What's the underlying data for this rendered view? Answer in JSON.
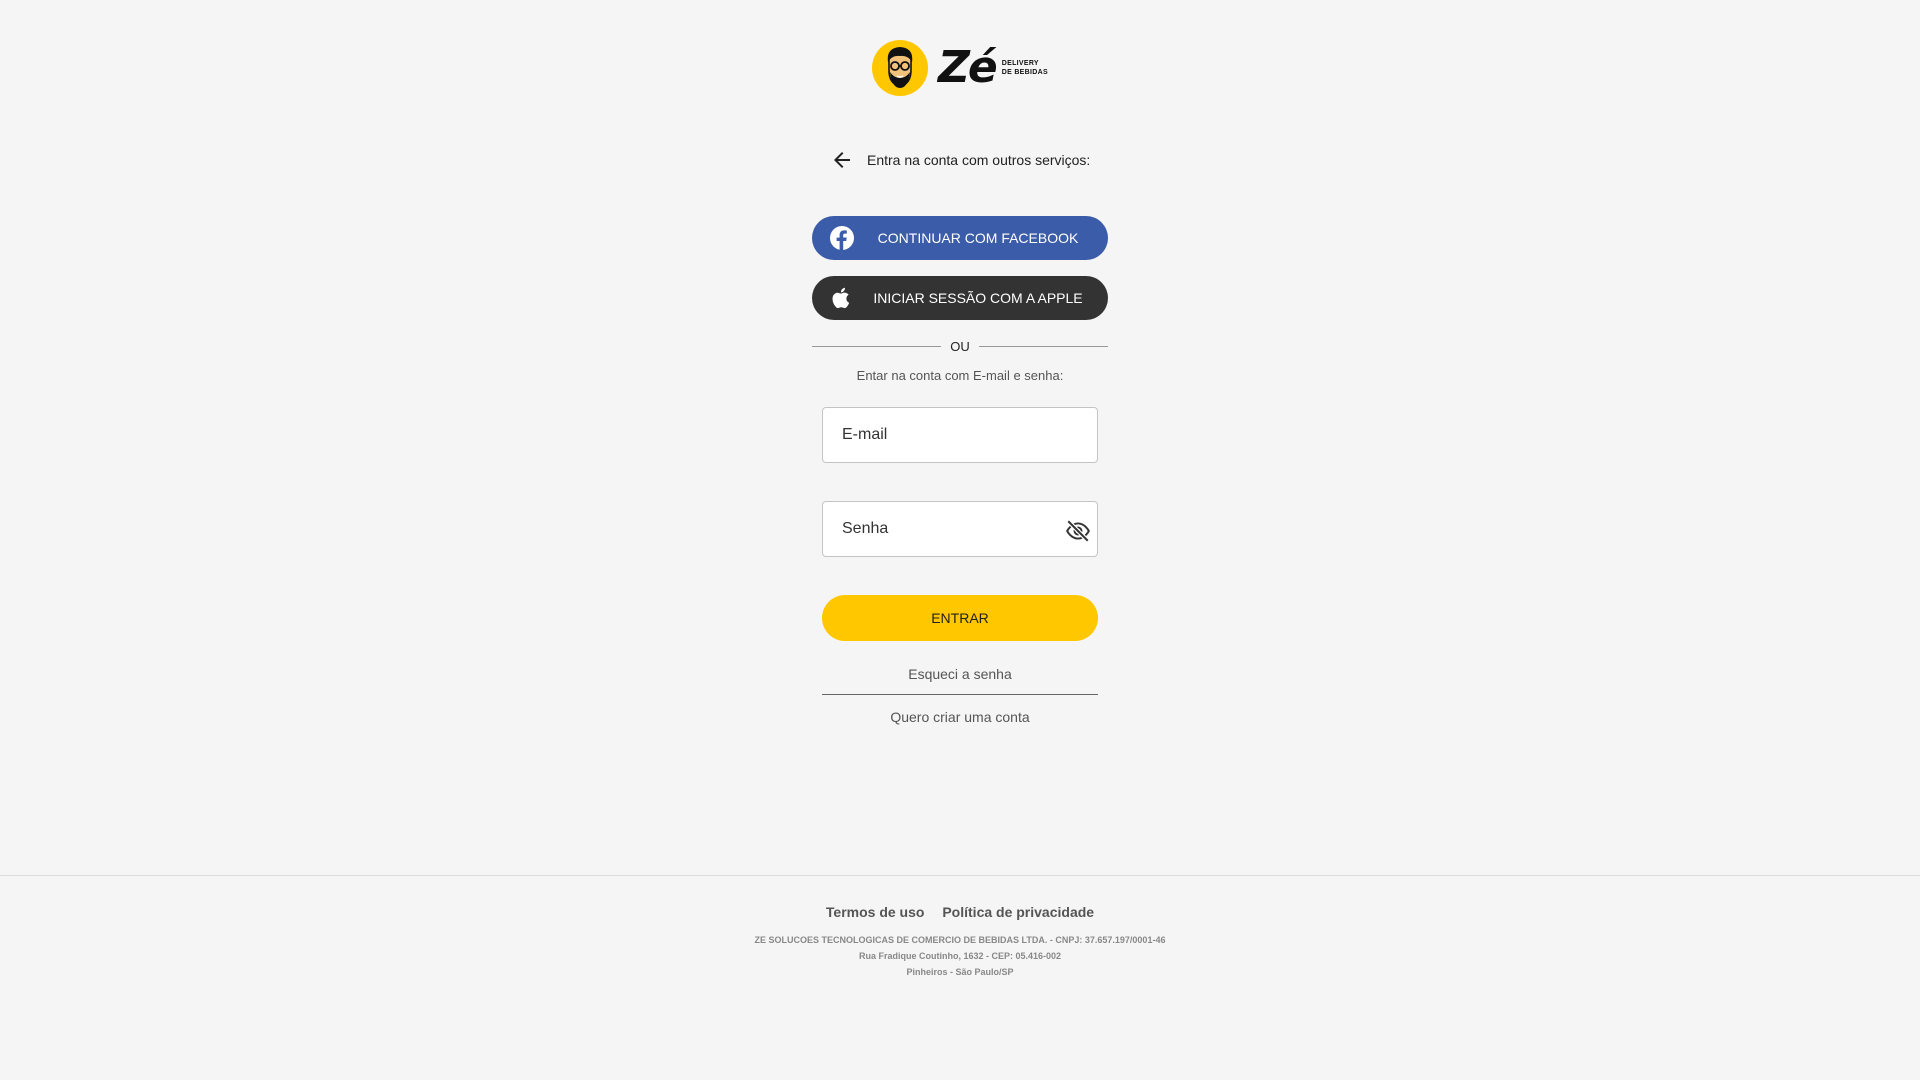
{
  "brand": {
    "wordmark": "Zé",
    "tagline_line1": "DELIVERY",
    "tagline_line2": "DE BEBIDAS",
    "color": "#ffc700"
  },
  "login": {
    "back_icon": "arrow-left-icon",
    "other_services_text": "Entra na conta com outros serviços:",
    "facebook_label": "CONTINUAR COM FACEBOOK",
    "facebook_color": "#3b5ca8",
    "apple_label": "INICIAR SESSÃO COM A APPLE",
    "apple_color": "#333333",
    "divider_label": "OU",
    "email_hint": "Entar na conta com E-mail e senha:",
    "email_placeholder": "E-mail",
    "password_placeholder": "Senha",
    "password_toggle_icon": "eye-off-icon",
    "submit_label": "ENTRAR",
    "submit_color": "#ffc700",
    "forgot_label": "Esqueci a senha",
    "create_label": "Quero criar uma conta"
  },
  "footer": {
    "terms_label": "Termos de uso",
    "privacy_label": "Política de privacidade",
    "legal_line1": "ZE SOLUCOES TECNOLOGICAS DE COMERCIO DE BEBIDAS LTDA. - CNPJ: 37.657.197/0001-46",
    "legal_line2": "Rua Fradique Coutinho, 1632 - CEP: 05.416-002",
    "legal_line3": "Pinheiros - São Paulo/SP"
  }
}
